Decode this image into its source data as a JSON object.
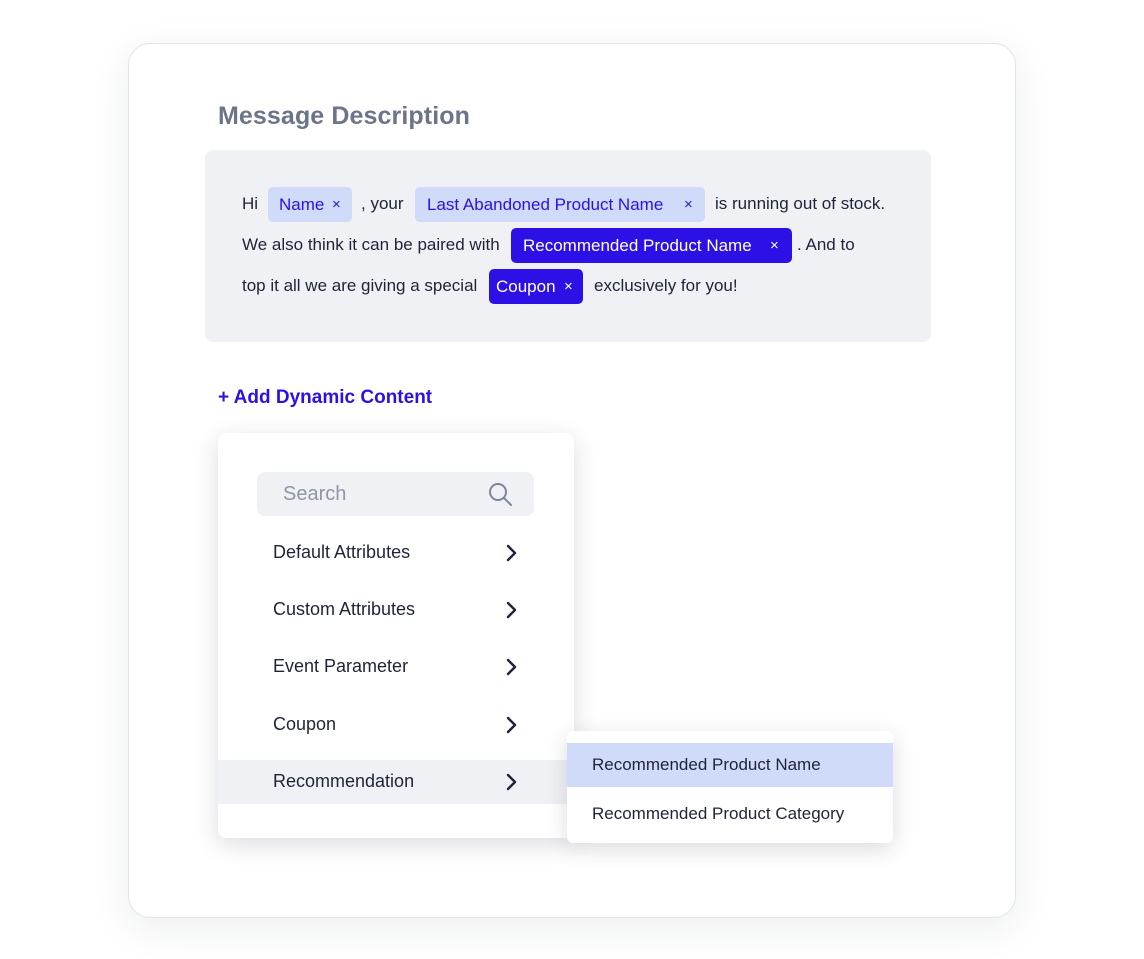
{
  "heading": "Message Description",
  "message": {
    "line1": {
      "hi": "Hi",
      "your": ", your",
      "rest": "is running out of stock."
    },
    "line2": {
      "start": "We also think it can be paired with",
      "rest": ". And to"
    },
    "line3": {
      "start": "top it all we are giving a special",
      "rest": "exclusively for you!"
    },
    "chips": {
      "name": "Name",
      "last_abandoned": "Last Abandoned Product Name",
      "recommended_name": "Recommended Product Name",
      "coupon": "Coupon",
      "remove_glyph": "×"
    }
  },
  "add_dynamic_label": "+ Add Dynamic Content",
  "dropdown": {
    "search_placeholder": "Search",
    "items": [
      {
        "label": "Default Attributes"
      },
      {
        "label": "Custom Attributes"
      },
      {
        "label": "Event Parameter"
      },
      {
        "label": "Coupon"
      },
      {
        "label": "Recommendation"
      }
    ],
    "active_item": "Recommendation"
  },
  "submenu": {
    "items": [
      {
        "label": "Recommended Product Name"
      },
      {
        "label": "Recommended Product Category"
      }
    ],
    "selected_item": "Recommended Product Name"
  },
  "colors": {
    "accent": "#2c10e5",
    "chip_light": "#cfdbf9",
    "panel_bg": "#eff1f5",
    "text": "#1e2438",
    "heading": "#6b7488"
  },
  "icons": {
    "search": "search-icon",
    "chevron": "chevron-right-icon",
    "remove": "close-icon"
  }
}
